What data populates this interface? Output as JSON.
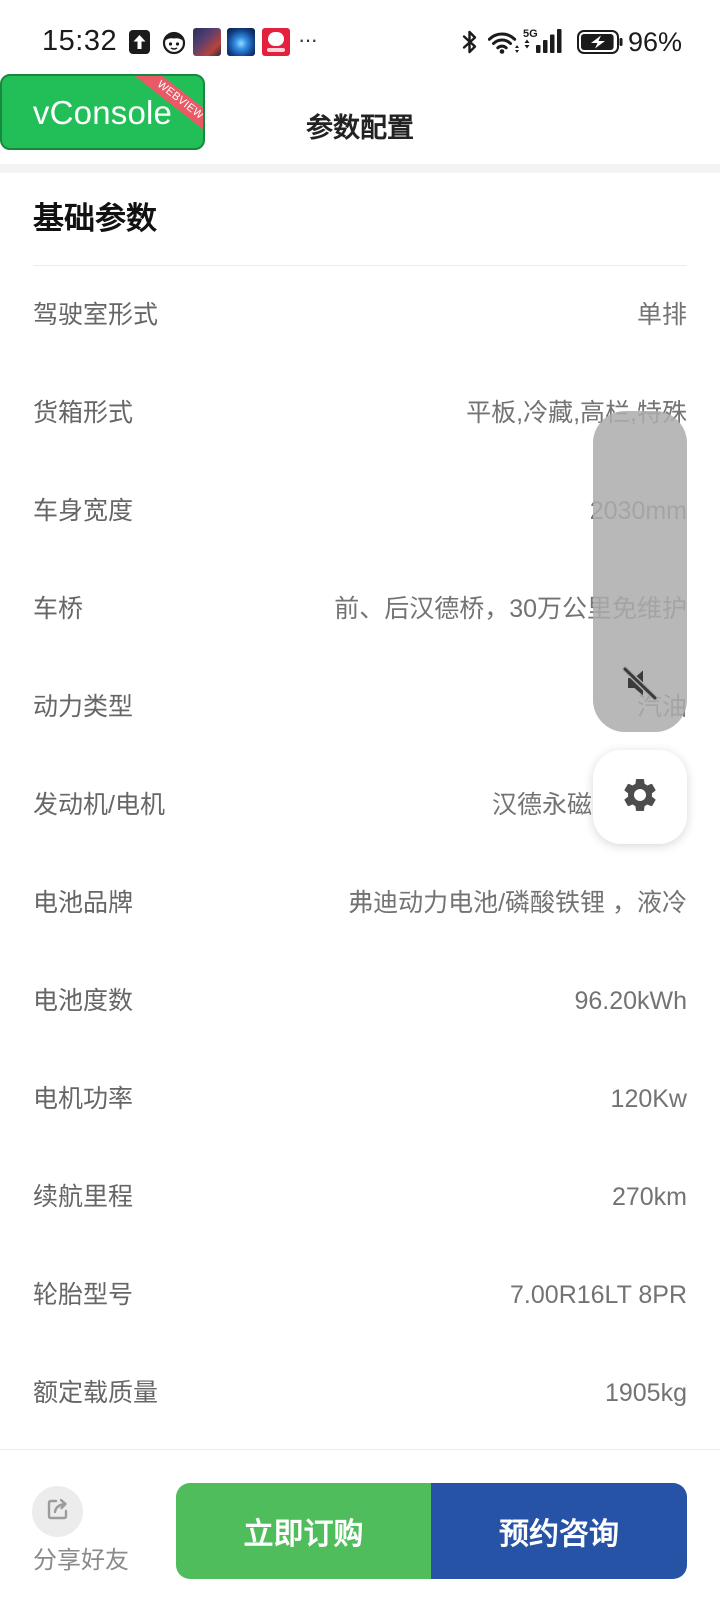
{
  "status_bar": {
    "time": "15:32",
    "more_indicator": "···",
    "network_type": "5G",
    "signal_bars": 4,
    "battery_text": "96%",
    "battery_level": 0.96,
    "icons": {
      "upload": "upload-icon",
      "face": "face-icon",
      "apps": [
        "app-notification-icon",
        "app-notification-icon",
        "app-notification-icon"
      ],
      "bluetooth": "bluetooth-icon",
      "wifi": "wifi-icon",
      "signal": "signal-icon",
      "battery": "battery-charging-icon"
    }
  },
  "vconsole": {
    "label": "vConsole",
    "ribbon": "WEBVIEW"
  },
  "header": {
    "title": "参数配置"
  },
  "section": {
    "title": "基础参数"
  },
  "params": [
    {
      "label": "驾驶室形式",
      "value": "单排"
    },
    {
      "label": "货箱形式",
      "value": "平板,冷藏,高栏,特殊"
    },
    {
      "label": "车身宽度",
      "value": "2030mm"
    },
    {
      "label": "车桥",
      "value": "前、后汉德桥，30万公里免维护"
    },
    {
      "label": "动力类型",
      "value": "汽油"
    },
    {
      "label": "发动机/电机",
      "value": "汉德永磁"
    },
    {
      "label": "电池品牌",
      "value": "弗迪动力电池/磷酸铁锂 ，液冷"
    },
    {
      "label": "电池度数",
      "value": "96.20kWh"
    },
    {
      "label": "电机功率",
      "value": "120Kw"
    },
    {
      "label": "续航里程",
      "value": "270km"
    },
    {
      "label": "轮胎型号",
      "value": "7.00R16LT 8PR"
    },
    {
      "label": "额定载质量",
      "value": "1905kg"
    }
  ],
  "floating_controls": {
    "volume_level": 0,
    "volume_icon": "volume-off-icon",
    "settings_icon": "gear-icon"
  },
  "bottom_bar": {
    "share_icon": "share-icon",
    "share_label": "分享好友",
    "buy_label": "立即订购",
    "consult_label": "预约咨询"
  },
  "colors": {
    "vconsole": "#22bf58",
    "ribbon": "#ea5a66",
    "buy": "#50bd5d",
    "consult": "#2753a6",
    "label_text": "#666666",
    "value_text": "#737373"
  }
}
